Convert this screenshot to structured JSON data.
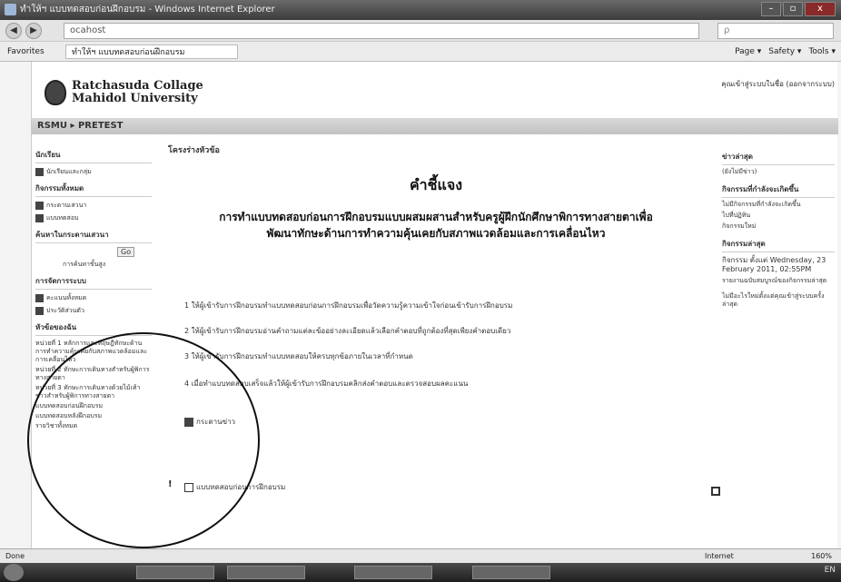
{
  "window": {
    "title": "ทำให้ฯ แบบทดสอบก่อนฝึกอบรม - Windows Internet Explorer",
    "controls": [
      "–",
      "▫",
      "x"
    ]
  },
  "address": {
    "back": "◀",
    "forward": "▶",
    "url": "ocahost",
    "search_placeholder": "ρ"
  },
  "favorites": {
    "label": "Favorites",
    "tab": "ทำให้ฯ แบบทดสอบก่อนฝึกอบรม",
    "tools": [
      "Page ▾",
      "Safety ▾",
      "Tools ▾"
    ]
  },
  "header": {
    "college_line1": "Ratchasuda Collage",
    "college_line2": "Mahidol University",
    "login_info": "คุณเข้าสู่ระบบในชื่อ (ออกจากระบบ)",
    "breadcrumb": "RSMU ▸ PRETEST"
  },
  "left": {
    "block1_title": "นักเรียน",
    "block1_items": [
      "นักเรียนและกลุ่ม"
    ],
    "block2_title": "กิจกรรมทั้งหมด",
    "block2_items": [
      "กระดานเสวนา",
      "แบบทดสอบ"
    ],
    "block3_title": "ค้นหาในกระดานเสวนา",
    "go_label": "Go",
    "advanced_search": "การค้นหาขั้นสูง",
    "block4_title": "การจัดการระบบ",
    "block4_items": [
      "คะแนนทั้งหมด",
      "ประวัติส่วนตัว"
    ],
    "block5_title": "หัวข้อของฉัน",
    "topics": [
      "หน่วยที่ 1 หลักการและทฤษฎีทักษะด้านการทำความคุ้นเคยกับสภาพแวดล้อมและการเคลื่อนไหว",
      "หน่วยที่ 2 ทักษะการเดินทางสำหรับผู้พิการทางสายตา",
      "หน่วยที่ 3 ทักษะการเดินทางด้วยไม้เท้าขาวสำหรับผู้พิการทางสายตา",
      "แบบทดสอบก่อนฝึกอบรม",
      "แบบทดสอบหลังฝึกอบรม",
      "รายวิชาทั้งหมด"
    ]
  },
  "center": {
    "header": "โครงร่างหัวข้อ",
    "heading1": "คำชี้แจง",
    "heading2_line1": "การทำแบบทดสอบก่อนการฝึกอบรมแบบผสมผสานสำหรับครูผู้ฝึกนักศึกษาพิการทางสายตาเพื่อ",
    "heading2_line2": "พัฒนาทักษะด้านการทำความคุ้นเคยกับสภาพแวดล้อมและการเคลื่อนไหว",
    "instructions": [
      "1 ให้ผู้เข้ารับการฝึกอบรมทำแบบทดสอบก่อนการฝึกอบรมเพื่อวัดความรู้ความเข้าใจก่อนเข้ารับการฝึกอบรม",
      "2 ให้ผู้เข้ารับการฝึกอบรมอ่านคำถามแต่ละข้ออย่างละเอียดแล้วเลือกคำตอบที่ถูกต้องที่สุดเพียงคำตอบเดียว",
      "3 ให้ผู้เข้ารับการฝึกอบรมทำแบบทดสอบให้ครบทุกข้อภายในเวลาที่กำหนด",
      "4 เมื่อทำแบบทดสอบเสร็จแล้วให้ผู้เข้ารับการฝึกอบรมคลิกส่งคำตอบและตรวจสอบผลคะแนน"
    ],
    "resource_label": "กระดานข่าว",
    "quiz_label": "แบบทดสอบก่อนการฝึกอบรม"
  },
  "right": {
    "block1_title": "ข่าวล่าสุด",
    "block1_body": "(ยังไม่มีข่าว)",
    "block2_title": "กิจกรรมที่กำลังจะเกิดขึ้น",
    "block2_body": "ไม่มีกิจกรรมที่กำลังจะเกิดขึ้น",
    "block2_links": [
      "ไปที่ปฏิทิน",
      "กิจกรรมใหม่"
    ],
    "block3_title": "กิจกรรมล่าสุด",
    "block3_body": "กิจกรรม ตั้งแต่ Wednesday, 23 February 2011, 02:55PM",
    "block3_detail": "รายงานฉบับสมบูรณ์ของกิจกรรมล่าสุด",
    "block3_footer": "ไม่มีอะไรใหม่ตั้งแต่คุณเข้าสู่ระบบครั้งล่าสุด"
  },
  "status": {
    "left": "Done",
    "zone": "Internet",
    "zoom": "160%"
  }
}
